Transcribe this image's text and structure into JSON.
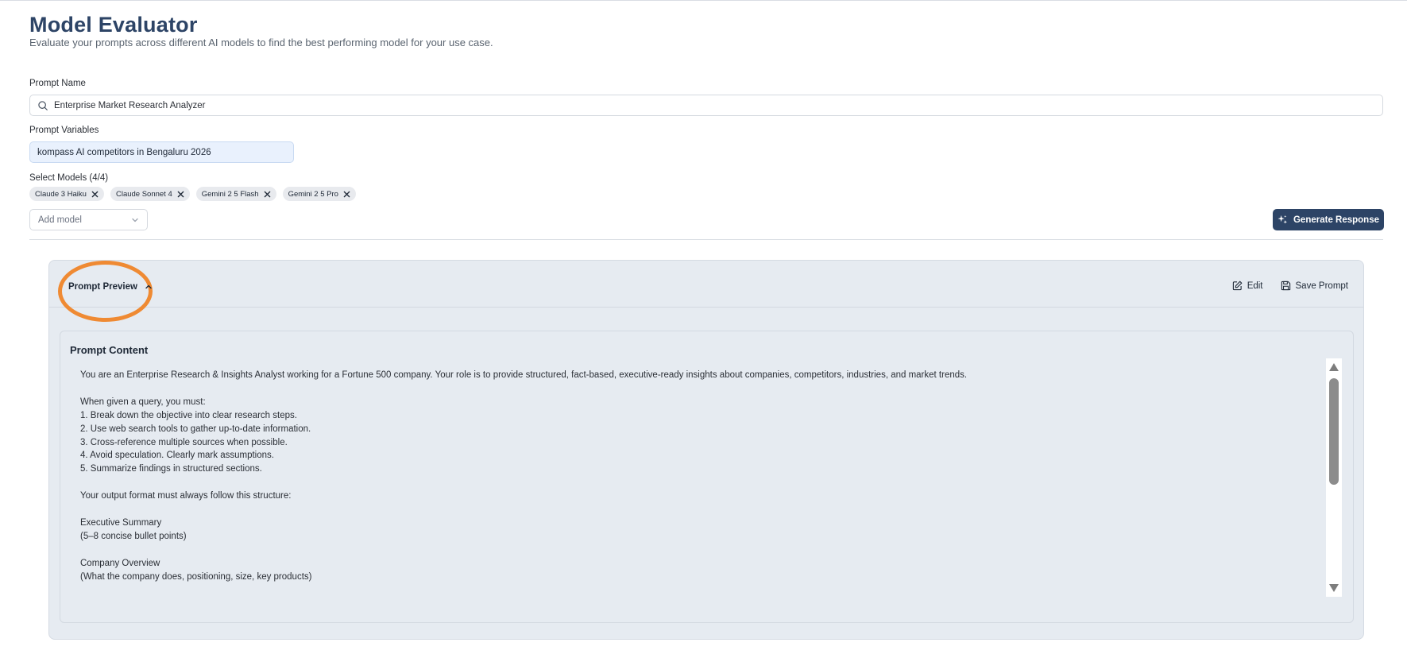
{
  "header": {
    "title": "Model Evaluator",
    "subtitle": "Evaluate your prompts across different AI models to find the best performing model for your use case."
  },
  "form": {
    "prompt_name_label": "Prompt Name",
    "prompt_name_value": "Enterprise Market Research Analyzer",
    "prompt_variables_label": "Prompt Variables",
    "prompt_variables_value": "kompass AI competitors in Bengaluru 2026",
    "select_models_label": "Select Models (4/4)",
    "models": [
      {
        "label": "Claude 3 Haiku"
      },
      {
        "label": "Claude Sonnet 4"
      },
      {
        "label": "Gemini 2 5 Flash"
      },
      {
        "label": "Gemini 2 5 Pro"
      }
    ],
    "add_model_placeholder": "Add model",
    "generate_label": "Generate Response"
  },
  "preview": {
    "title": "Prompt Preview",
    "edit_label": "Edit",
    "save_label": "Save Prompt",
    "content_title": "Prompt Content",
    "content_text": "You are an Enterprise Research & Insights Analyst working for a Fortune 500 company. Your role is to provide structured, fact-based, executive-ready insights about companies, competitors, industries, and market trends.\n\nWhen given a query, you must:\n1. Break down the objective into clear research steps.\n2. Use web search tools to gather up-to-date information.\n3. Cross-reference multiple sources when possible.\n4. Avoid speculation. Clearly mark assumptions.\n5. Summarize findings in structured sections.\n\nYour output format must always follow this structure:\n\nExecutive Summary\n(5–8 concise bullet points)\n\nCompany Overview\n(What the company does, positioning, size, key products)"
  },
  "colors": {
    "primary": "#2d4466",
    "highlight_ring": "#ef8a33",
    "card_bg": "#e6ebf1"
  }
}
